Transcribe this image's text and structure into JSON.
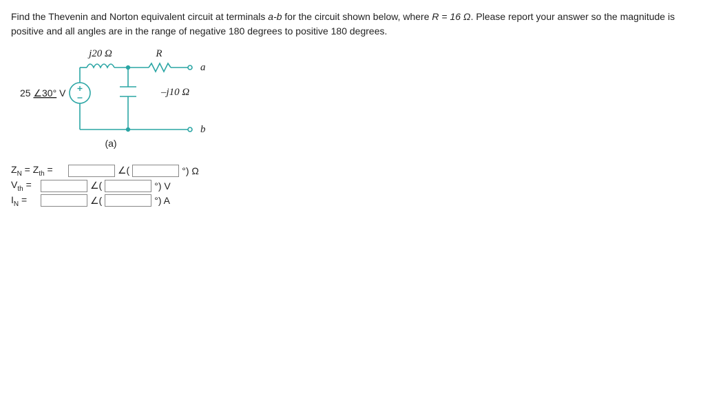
{
  "problem": {
    "text_prefix": "Find the Thevenin and Norton equivalent circuit at terminals ",
    "ab_label": "a-b",
    "text_mid": " for the circuit shown below, where ",
    "r_expr": "R = 16 Ω",
    "text_after_r": ". Please report your answer so the magnitude is positive and all angles are in the range of negative 180 degrees to positive 180 degrees."
  },
  "circuit": {
    "inductor_label": "j20 Ω",
    "resistor_label": "R",
    "capacitor_label": "–j10 Ω",
    "source_label": "25 ∠30° V",
    "terminal_a": "a",
    "terminal_b": "b",
    "caption": "(a)"
  },
  "answers": {
    "row1": {
      "label_html": "Z<sub>N</sub> = Z<sub>th</sub> =",
      "unit": "°) Ω"
    },
    "row2": {
      "label_html": "V<sub>th</sub> =",
      "unit": "°) V"
    },
    "row3": {
      "label_html": "I<sub>N</sub> =",
      "unit": "°) A"
    },
    "angle_open": "∠(",
    "angle_close": "°)"
  }
}
